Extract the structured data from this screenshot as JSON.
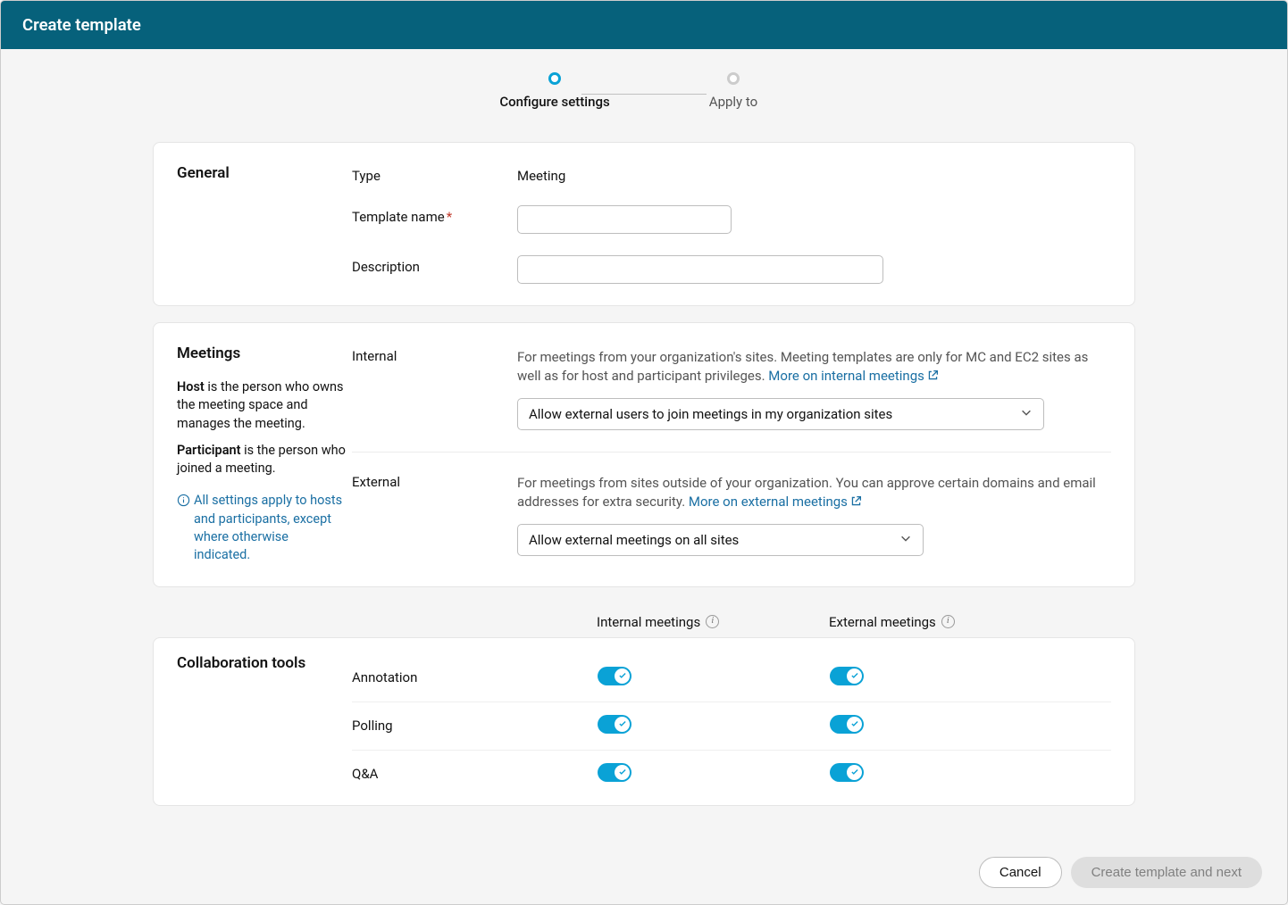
{
  "header": {
    "title": "Create template"
  },
  "stepper": {
    "step1": "Configure settings",
    "step2": "Apply to"
  },
  "general": {
    "title": "General",
    "type_label": "Type",
    "type_value": "Meeting",
    "name_label": "Template name",
    "desc_label": "Description"
  },
  "meetings": {
    "title": "Meetings",
    "host_word": "Host",
    "host_text": " is the person who owns the meeting space and manages the meeting.",
    "participant_word": "Participant",
    "participant_text": " is the person who joined a meeting.",
    "note": "All settings apply to hosts and participants, except where otherwise indicated.",
    "internal": {
      "label": "Internal",
      "desc": "For meetings from your organization's sites. Meeting templates are only for MC and EC2 sites as well as for host and participant privileges. ",
      "link": "More on internal meetings",
      "select": "Allow external users to join meetings in my organization sites"
    },
    "external": {
      "label": "External",
      "desc": "For meetings from sites outside of your organization. You can approve certain domains and email addresses for extra security. ",
      "link": "More on external meetings",
      "select": "Allow external meetings on all sites"
    }
  },
  "collab": {
    "title": "Collaboration tools",
    "col_internal": "Internal meetings",
    "col_external": "External meetings",
    "tools": {
      "annotation": "Annotation",
      "polling": "Polling",
      "qa": "Q&A"
    }
  },
  "footer": {
    "cancel": "Cancel",
    "next": "Create template and next"
  }
}
